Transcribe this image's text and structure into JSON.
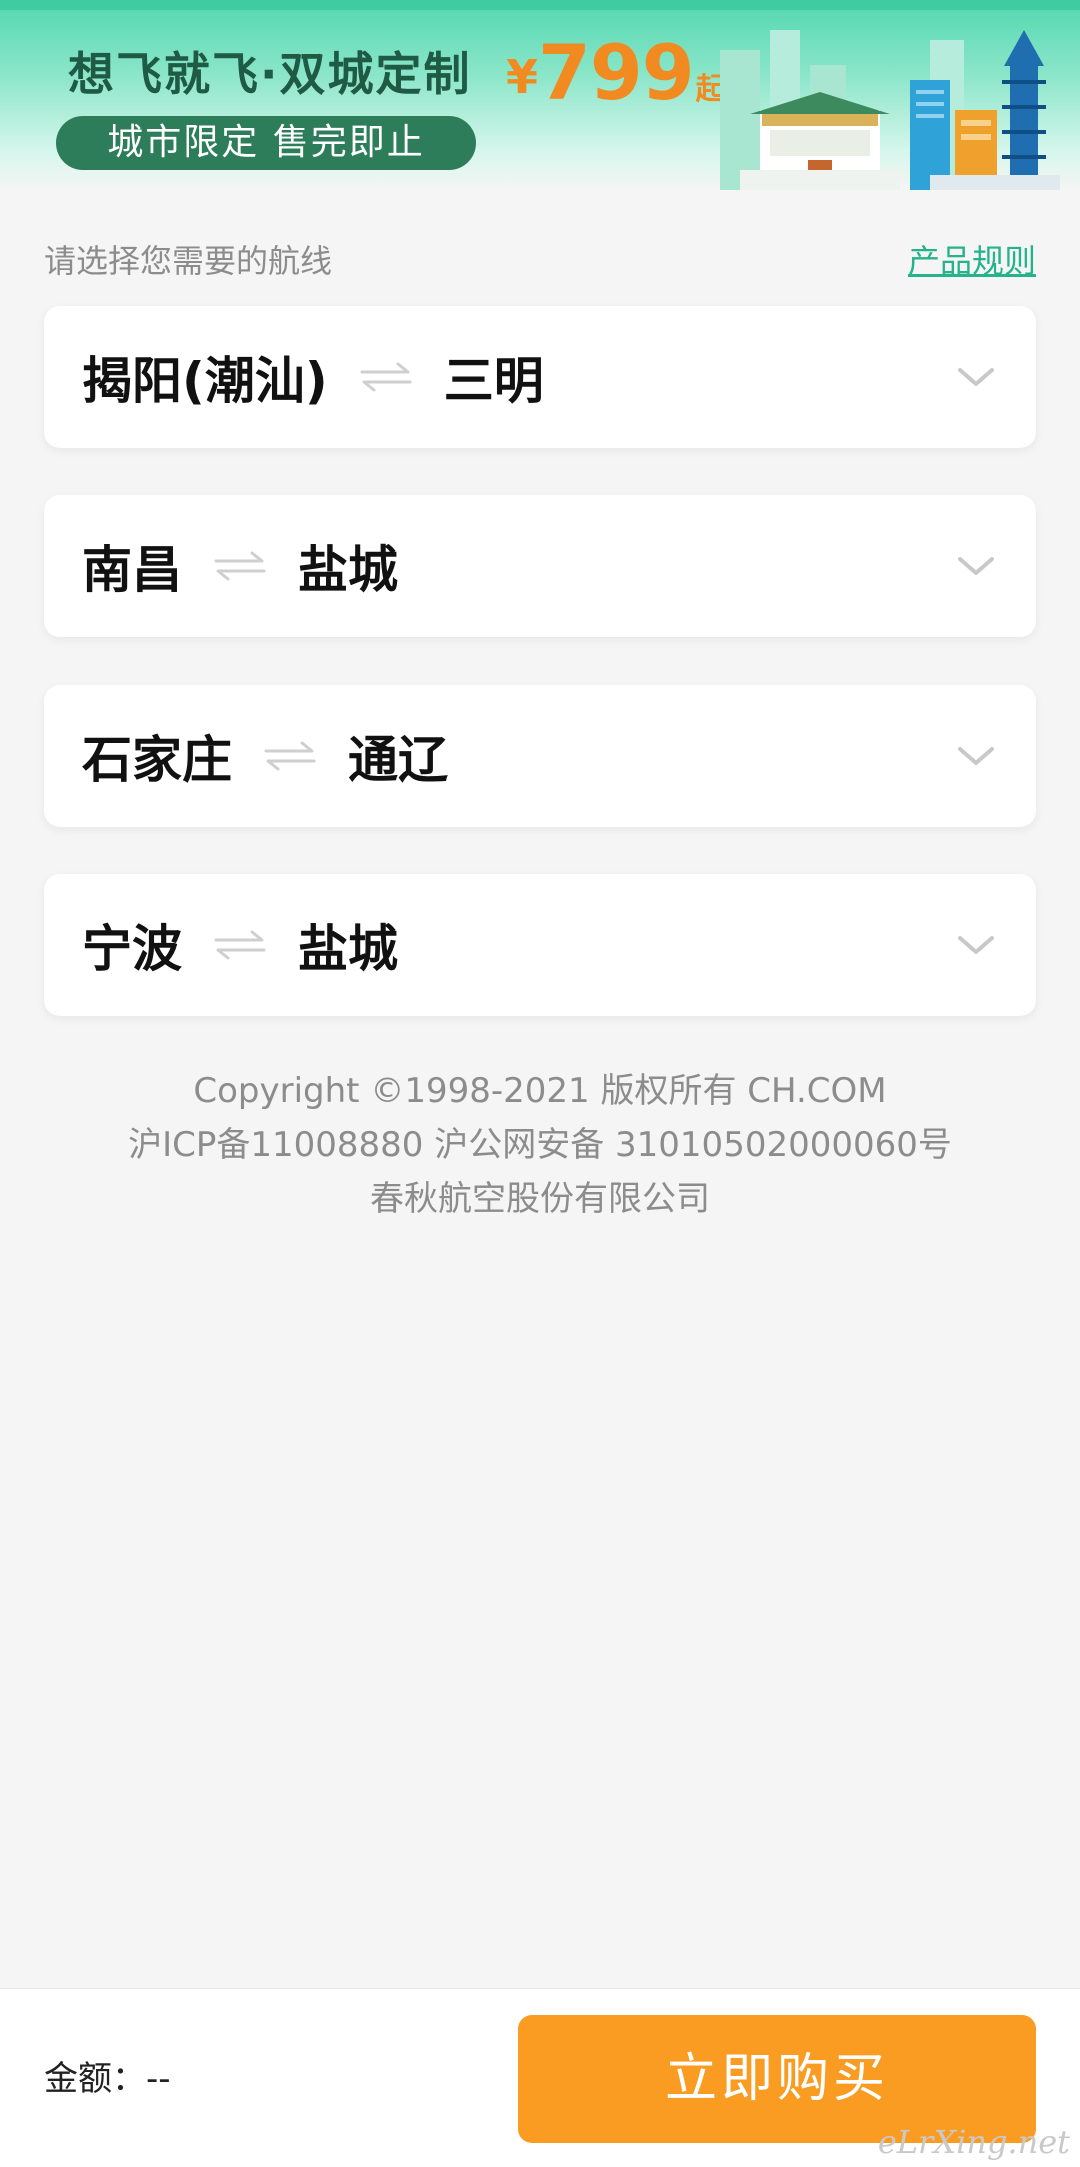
{
  "banner": {
    "title": "想飞就飞·双城定制",
    "price_currency": "¥",
    "price_value": "799",
    "price_suffix": "起",
    "pill_text": "城市限定 售完即止",
    "colors": {
      "gradient_top": "#52d7b0",
      "price": "#f28a22",
      "pill": "#2d7d5a"
    }
  },
  "section": {
    "hint": "请选择您需要的航线",
    "rules_link": "产品规则"
  },
  "routes": [
    {
      "from": "揭阳(潮汕)",
      "to": "三明"
    },
    {
      "from": "南昌",
      "to": "盐城"
    },
    {
      "from": "石家庄",
      "to": "通辽"
    },
    {
      "from": "宁波",
      "to": "盐城"
    }
  ],
  "icons": {
    "swap": "swap-arrows-icon",
    "expand": "chevron-down-icon"
  },
  "footer": {
    "line1": "Copyright ©1998-2021 版权所有 CH.COM",
    "line2": "沪ICP备11008880 沪公网安备 31010502000060号",
    "line3": "春秋航空股份有限公司"
  },
  "bottom_bar": {
    "amount_label": "金额：",
    "amount_value": "--",
    "buy_label": "立即购买",
    "buy_color": "#fa9b22"
  },
  "watermark": "eLrXing.net"
}
